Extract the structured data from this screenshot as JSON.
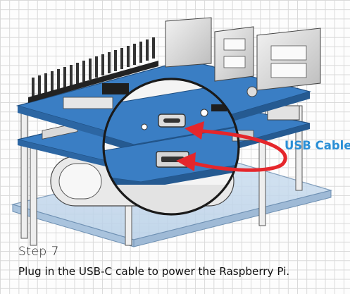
{
  "callout": {
    "label": "USB Cable",
    "color": "#2b8fd6"
  },
  "step": {
    "title": "Step 7",
    "text": "Plug in the USB-C cable to power the Raspberry Pi."
  },
  "colors": {
    "board_blue": "#3a7ec4",
    "arrow_red": "#e5262b",
    "zoom_ring": "#1a1a1a"
  }
}
